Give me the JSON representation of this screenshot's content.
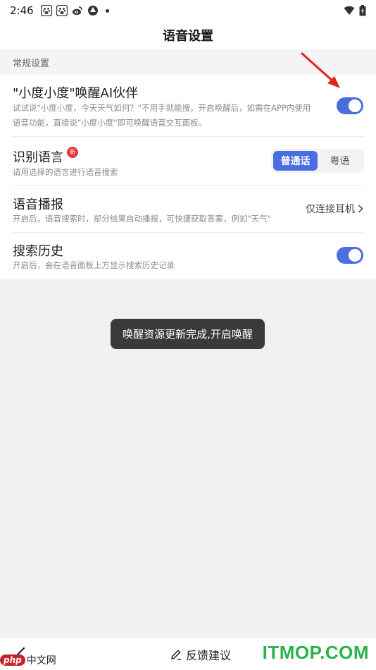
{
  "status_bar": {
    "time": "2:46",
    "icons": [
      "baidu-paw-icon",
      "baidu-paw-icon",
      "weibo-icon",
      "app-icon"
    ],
    "right_icons": [
      "wifi-icon",
      "battery-icon"
    ]
  },
  "header": {
    "title": "语音设置"
  },
  "section": {
    "title": "常规设置"
  },
  "settings": {
    "wake": {
      "title": "\"小度小度\"唤醒AI伙伴",
      "desc_line1": "试试说\"小度小度，今天天气如何？\"不用手就能搜。开启唤醒后，如需在APP内使用",
      "desc_line2": "语音功能，直接说\"小度小度\"即可唤醒语音交互面板。",
      "enabled": true
    },
    "language": {
      "title": "识别语言",
      "badge": "新",
      "desc": "请用选择的语言进行语音搜索",
      "options": [
        "普通话",
        "粤语"
      ],
      "selected": "普通话"
    },
    "broadcast": {
      "title": "语音播报",
      "desc": "开启后，语音搜索时，部分结果自动播报，可快捷获取答案，例如\"天气\"",
      "value": "仅连接耳机"
    },
    "history": {
      "title": "搜索历史",
      "desc": "开启后，会在语音面板上方显示搜索历史记录",
      "enabled": true
    }
  },
  "toast": {
    "text": "唤醒资源更新完成,开启唤醒"
  },
  "bottom_bar": {
    "feedback_label": "反馈建议"
  },
  "watermarks": {
    "left_badge": "php",
    "left_text": "中文网",
    "right_text": "ITMOP.COM"
  },
  "colors": {
    "accent": "#4a6ee0",
    "badge": "#e8383d",
    "annotation_arrow": "#e0241b",
    "watermark_green": "#2bb24c"
  }
}
